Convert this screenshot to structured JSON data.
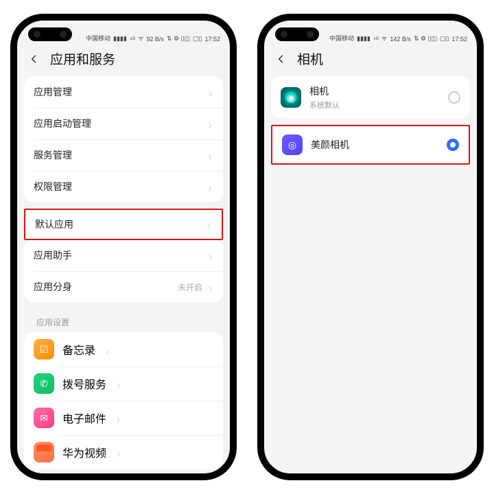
{
  "status": {
    "carrier": "中国移动",
    "net": "⁴ᴳ",
    "signal": "▮▮▮▮",
    "wifi_icon": "????",
    "speed": "92 B/s",
    "speed2": "142 B/s",
    "icons": "⇅ ⚙ ▯◫",
    "battery": "▢▯",
    "time": "17:52"
  },
  "left": {
    "title": "应用和服务",
    "group1": [
      "应用管理",
      "应用启动管理",
      "服务管理",
      "权限管理"
    ],
    "default_app": "默认应用",
    "group2": {
      "assistant": "应用助手",
      "clone": "应用分身",
      "clone_value": "未开启"
    },
    "section": "应用设置",
    "apps": [
      {
        "name": "备忘录",
        "icon": "ic-memo",
        "glyph": "☑"
      },
      {
        "name": "拨号服务",
        "icon": "ic-phone",
        "glyph": "✆"
      },
      {
        "name": "电子邮件",
        "icon": "ic-mail",
        "glyph": "✉"
      },
      {
        "name": "华为视频",
        "icon": "ic-video",
        "glyph": ""
      }
    ]
  },
  "right": {
    "title": "相机",
    "options": [
      {
        "name": "相机",
        "sub": "系统默认",
        "icon": "ic-camera",
        "glyph": "◉",
        "selected": false
      },
      {
        "name": "美颜相机",
        "sub": "",
        "icon": "ic-beauty",
        "glyph": "◎",
        "selected": true,
        "highlight": true
      }
    ]
  }
}
